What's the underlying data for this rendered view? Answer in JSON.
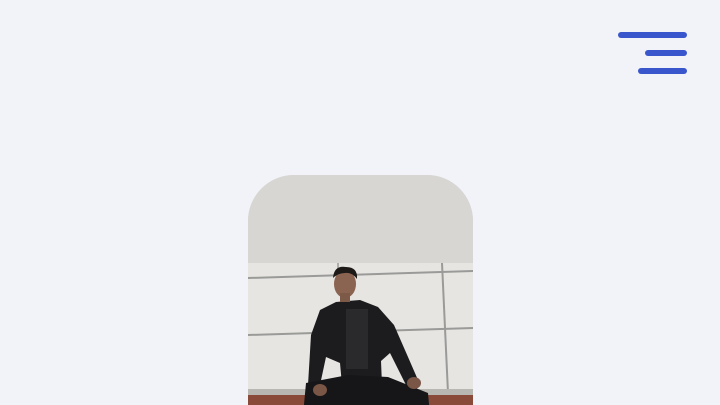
{
  "header": {
    "logo": {
      "icon": "m-logo-icon",
      "colors": [
        "#3a5bd9",
        "#6f8cf0"
      ]
    },
    "menu": {
      "icon": "hamburger-menu-icon",
      "color": "#3a56cc"
    }
  },
  "hero": {
    "photo": {
      "subject": "portrait-photo",
      "colors": {
        "sky": "#d7d6d3",
        "wall": "#e6e5e2",
        "suit": "#1c1c1f",
        "ledge": "#8a4a3a"
      }
    }
  },
  "theme": {
    "background": "#f1f3f8",
    "accent": "#3a56cc"
  }
}
